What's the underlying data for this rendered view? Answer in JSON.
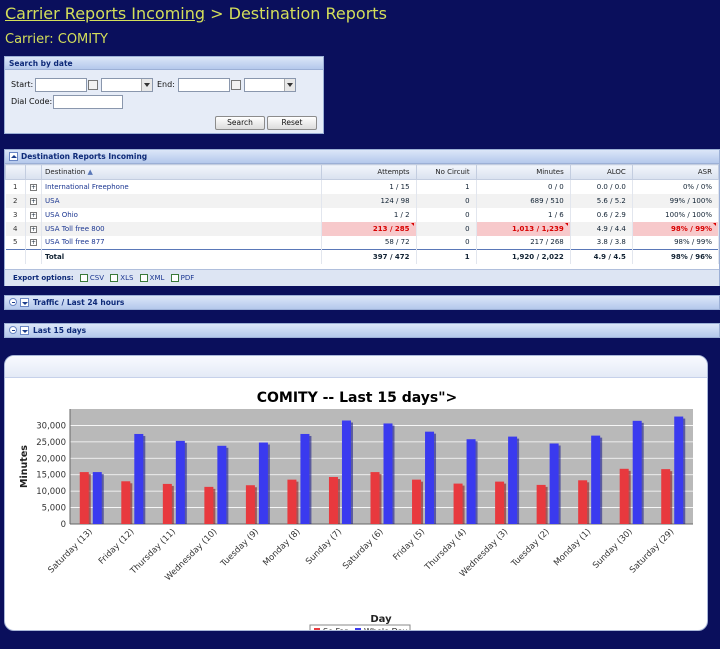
{
  "breadcrumb": {
    "link": "Carrier Reports Incoming",
    "separator": " > ",
    "current": "Destination Reports"
  },
  "carrier_label": "Carrier: COMITY",
  "search": {
    "header": "Search by date",
    "start_label": "Start:",
    "end_label": "End:",
    "dial_code_label": "Dial Code:",
    "start_value": "",
    "end_value": "",
    "dial_code_value": "",
    "search_button": "Search",
    "reset_button": "Reset"
  },
  "grid": {
    "header": "Destination Reports Incoming",
    "columns": [
      "Destination",
      "Attempts",
      "No Circuit",
      "Minutes",
      "ALOC",
      "ASR"
    ],
    "sort_indicator": "▲",
    "rows": [
      {
        "idx": "1",
        "dest": "International Freephone",
        "attempts": "1 / 15",
        "nocircuit": "1",
        "minutes": "0 / 0",
        "aloc": "0.0 / 0.0",
        "asr": "0% / 0%"
      },
      {
        "idx": "2",
        "dest": "USA",
        "attempts": "124 / 98",
        "nocircuit": "0",
        "minutes": "689 / 510",
        "aloc": "5.6 / 5.2",
        "asr": "99% / 100%"
      },
      {
        "idx": "3",
        "dest": "USA Ohio",
        "attempts": "1 / 2",
        "nocircuit": "0",
        "minutes": "1 / 6",
        "aloc": "0.6 / 2.9",
        "asr": "100% / 100%"
      },
      {
        "idx": "4",
        "dest": "USA Toll free 800",
        "attempts": "213 / 285",
        "nocircuit": "0",
        "minutes": "1,013 / 1,239",
        "aloc": "4.9 / 4.4",
        "asr": "98% / 99%"
      },
      {
        "idx": "5",
        "dest": "USA Toll free 877",
        "attempts": "58 / 72",
        "nocircuit": "0",
        "minutes": "217 / 268",
        "aloc": "3.8 / 3.8",
        "asr": "98% / 99%"
      }
    ],
    "total": {
      "label": "Total",
      "attempts": "397 / 472",
      "nocircuit": "1",
      "minutes": "1,920 / 2,022",
      "aloc": "4.9 / 4.5",
      "asr": "98% / 96%"
    },
    "export": {
      "label": "Export options:",
      "csv": "CSV",
      "xls": "XLS",
      "xml": "XML",
      "pdf": "PDF"
    }
  },
  "traffic_panel": "Traffic / Last 24 hours",
  "last15_panel": "Last 15 days",
  "colors": {
    "background": "#0a0f5c",
    "title": "#d4df5a",
    "so_far": "#e8393e",
    "whole_day": "#3a3aef"
  },
  "chart_data": {
    "type": "bar",
    "title": "COMITY -- Last 15 days\">",
    "xlabel": "Day",
    "ylabel": "Minutes",
    "ylim": [
      0,
      35000
    ],
    "yticks": [
      "0",
      "5,000",
      "10,000",
      "15,000",
      "20,000",
      "25,000",
      "30,000"
    ],
    "categories": [
      "Saturday (13)",
      "Friday (12)",
      "Thursday (11)",
      "Wednesday (10)",
      "Tuesday (9)",
      "Monday (8)",
      "Sunday (7)",
      "Saturday (6)",
      "Friday (5)",
      "Thursday (4)",
      "Wednesday (3)",
      "Tuesday (2)",
      "Monday (1)",
      "Sunday (30)",
      "Saturday (29)"
    ],
    "series": [
      {
        "name": "So Far",
        "values": [
          15800,
          13000,
          12200,
          11300,
          11800,
          13500,
          14300,
          15800,
          13500,
          12300,
          12900,
          11900,
          13300,
          16800,
          16700
        ]
      },
      {
        "name": "Whole Day",
        "values": [
          15800,
          27400,
          25300,
          23800,
          24800,
          27400,
          31500,
          30600,
          28100,
          25800,
          26600,
          24500,
          26900,
          31400,
          32700
        ]
      }
    ],
    "grid": true,
    "legend": "bottom-center"
  }
}
